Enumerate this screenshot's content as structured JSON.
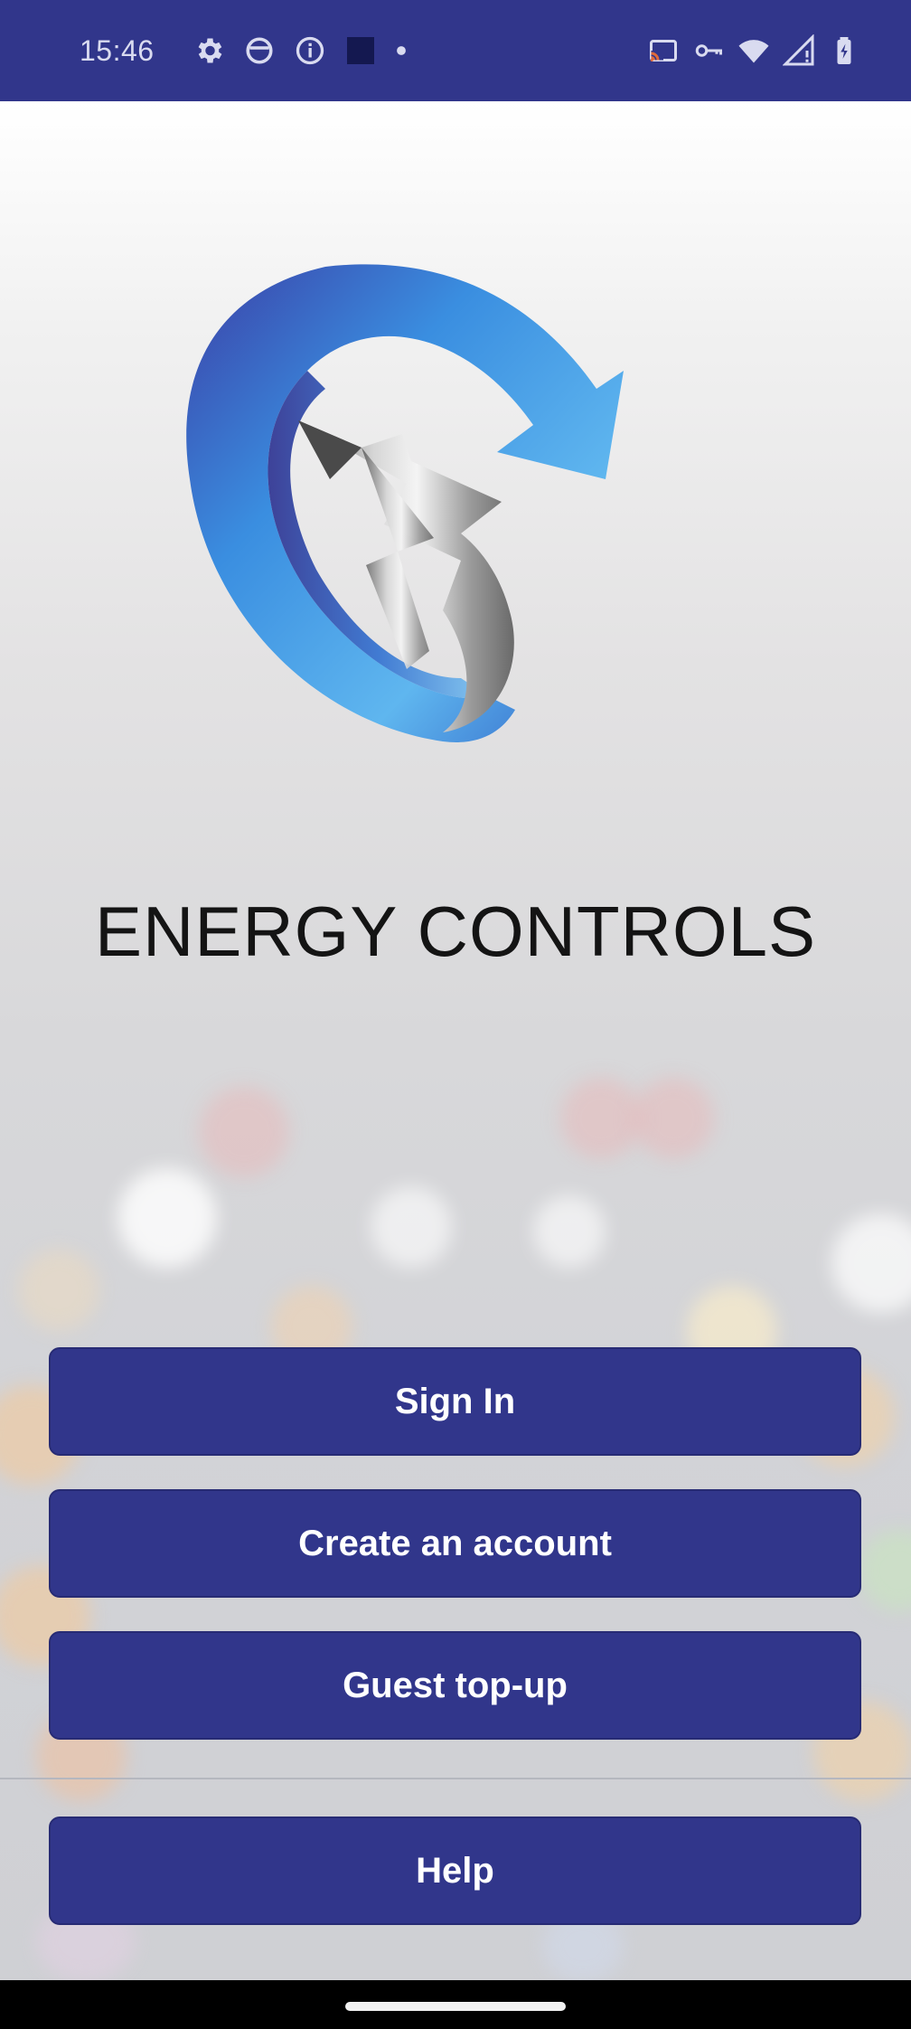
{
  "status_bar": {
    "time": "15:46",
    "left_icons": [
      "gear-icon",
      "face-icon",
      "info-icon",
      "square-icon",
      "dot-icon"
    ],
    "right_icons": [
      "cast-icon",
      "vpn-key-icon",
      "wifi-icon",
      "signal-icon",
      "battery-icon"
    ],
    "background": "#31368b"
  },
  "brand": {
    "name": "ENERGY CONTROLS"
  },
  "buttons": {
    "sign_in": "Sign In",
    "create_account": "Create an account",
    "guest_topup": "Guest top-up",
    "help": "Help"
  },
  "colors": {
    "button_background": "#31368b",
    "button_text": "#ffffff",
    "logo_blue": "#2f7fd8",
    "logo_silver": "#a8a8a8"
  }
}
